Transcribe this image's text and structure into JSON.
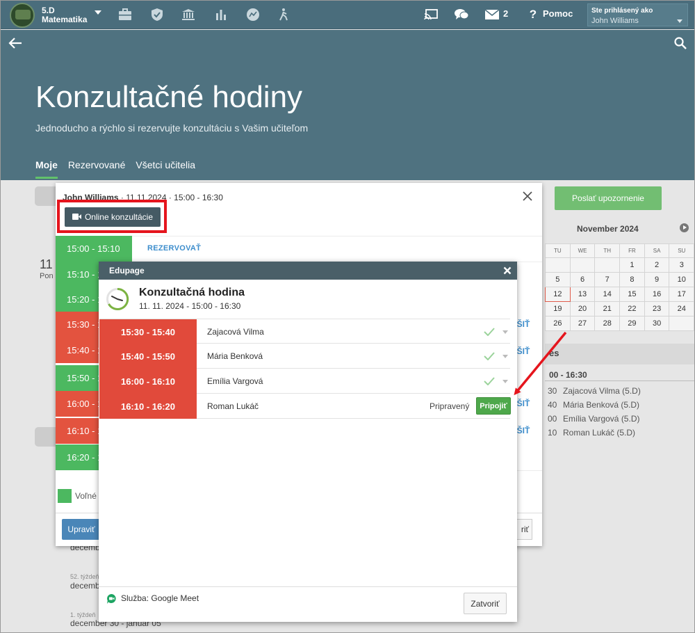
{
  "topbar": {
    "class_name": "5.D",
    "subject": "Matematika",
    "mail_count": "2",
    "help_label": "Pomoc",
    "login_label": "Ste prihlásený ako",
    "login_name": "John Williams",
    "colors": {
      "bar": "#4a6d7c",
      "header": "#4f7280"
    }
  },
  "header": {
    "title": "Konzultačné hodiny",
    "subtitle": "Jednoducho a rýchlo si rezervujte konzultáciu s Vašim učiteľom",
    "tabs": [
      {
        "label": "Moje",
        "active": true
      },
      {
        "label": "Rezervované",
        "active": false
      },
      {
        "label": "Všetci učitelia",
        "active": false
      }
    ]
  },
  "background": {
    "date_big": "11",
    "date_day": "Pon",
    "weeks": [
      {
        "label": "",
        "range": "decemb"
      },
      {
        "label": "52. týždeň",
        "range": "decemb"
      },
      {
        "label": "1. týždeň",
        "range": "december 30 - január 05"
      }
    ],
    "send_button": "Poslať upozornenie",
    "calendar": {
      "title": "November 2024",
      "weekday_headers": [
        "TU",
        "WE",
        "TH",
        "FR",
        "SA",
        "SU"
      ],
      "rows": [
        [
          "",
          "",
          "",
          "1",
          "2",
          "3"
        ],
        [
          "5",
          "6",
          "7",
          "8",
          "9",
          "10"
        ],
        [
          "12",
          "13",
          "14",
          "15",
          "16",
          "17"
        ],
        [
          "19",
          "20",
          "21",
          "22",
          "23",
          "24"
        ],
        [
          "26",
          "27",
          "28",
          "29",
          "30",
          ""
        ]
      ]
    },
    "side_title": "es",
    "side_time": "00 - 16:30",
    "side_list": [
      {
        "pre": "30",
        "name": "Zajacová Vilma (5.D)"
      },
      {
        "pre": "40",
        "name": "Mária Benková (5.D)"
      },
      {
        "pre": "00",
        "name": "Emília Vargová (5.D)"
      },
      {
        "pre": "10",
        "name": "Roman Lukáč (5.D)"
      }
    ]
  },
  "modal": {
    "teacher": "John Williams",
    "date_time": " · 11.11.2024 · 15:00 - 16:30",
    "online_button": "Online konzultácie",
    "reserve_link": "REZERVOVAŤ",
    "partial_link": "UŠIŤ",
    "slots": [
      {
        "label": "15:00 - 15:10",
        "status": "free"
      },
      {
        "label": "15:10 - 1",
        "status": "free"
      },
      {
        "label": "15:20 - 1",
        "status": "free"
      },
      {
        "label": "15:30 - 1",
        "status": "taken"
      },
      {
        "label": "15:40 - 1",
        "status": "taken"
      },
      {
        "label": "15:50 - 1",
        "status": "free"
      },
      {
        "label": "16:00 - 1",
        "status": "taken"
      },
      {
        "label": "16:10 - 1",
        "status": "taken"
      },
      {
        "label": "16:20 - 1",
        "status": "free"
      }
    ],
    "legend_free": "Voľné",
    "edit_button": "Upraviť",
    "close_partial": "riť"
  },
  "dialog": {
    "bar_title": "Edupage",
    "heading": "Konzultačná hodina",
    "subheading": "11. 11. 2024 - 15:00 - 16:30",
    "rows": [
      {
        "time": "15:30 - 15:40",
        "name": "Zajacová Vilma",
        "status": "",
        "action": ""
      },
      {
        "time": "15:40 - 15:50",
        "name": "Mária Benková",
        "status": "",
        "action": ""
      },
      {
        "time": "16:00 - 16:10",
        "name": "Emília Vargová",
        "status": "",
        "action": ""
      },
      {
        "time": "16:10 - 16:20",
        "name": "Roman Lukáč",
        "status": "Pripravený",
        "action": "Pripojiť"
      }
    ],
    "service": "Služba: Google Meet",
    "close_button": "Zatvoriť"
  },
  "icons": [
    "back-arrow-icon",
    "search-icon",
    "briefcase-icon",
    "shield-icon",
    "bank-icon",
    "bar-chart-icon",
    "timeline-icon",
    "walking-icon",
    "cast-icon",
    "chat-icon",
    "mail-icon",
    "help-icon",
    "close-icon",
    "video-camera-icon",
    "clock-icon",
    "check-icon",
    "google-meet-icon"
  ]
}
